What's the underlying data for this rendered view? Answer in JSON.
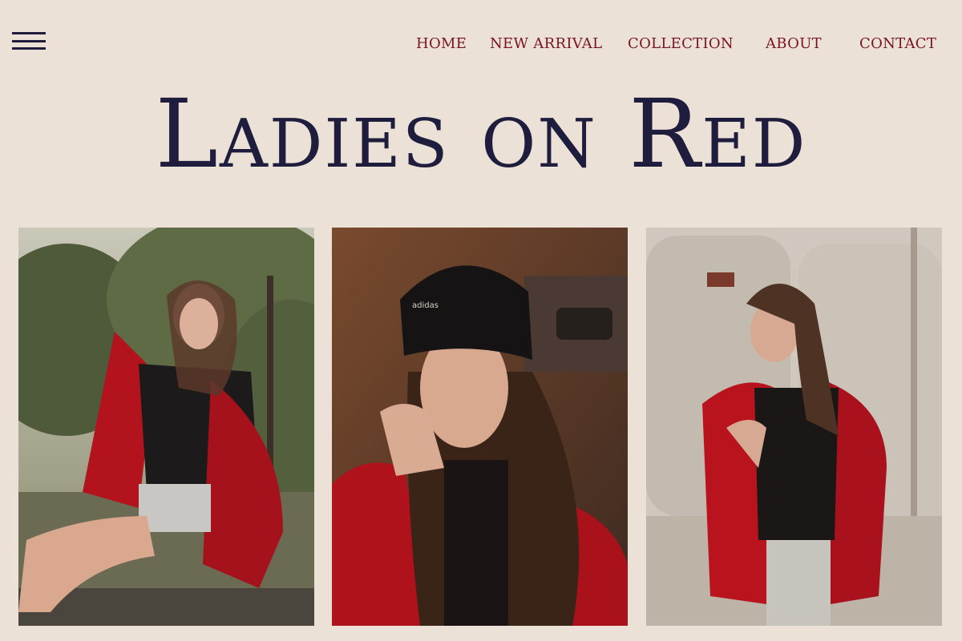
{
  "nav": {
    "menu_icon": "hamburger-menu-icon",
    "items": [
      "HOME",
      "NEW ARRIVAL",
      "COLLECTION",
      "ABOUT",
      "CONTACT"
    ]
  },
  "hero": {
    "title": "Ladies on Red"
  },
  "gallery": {
    "photos": [
      {
        "subject": "woman in red jacket sitting outdoors by trees"
      },
      {
        "subject": "woman in black beanie with hand on chin"
      },
      {
        "subject": "woman in red jacket near silos"
      }
    ]
  },
  "colors": {
    "background": "#ece1d6",
    "title": "#1f1d3d",
    "nav_text": "#7a1420",
    "accent_red": "#b3131d"
  }
}
